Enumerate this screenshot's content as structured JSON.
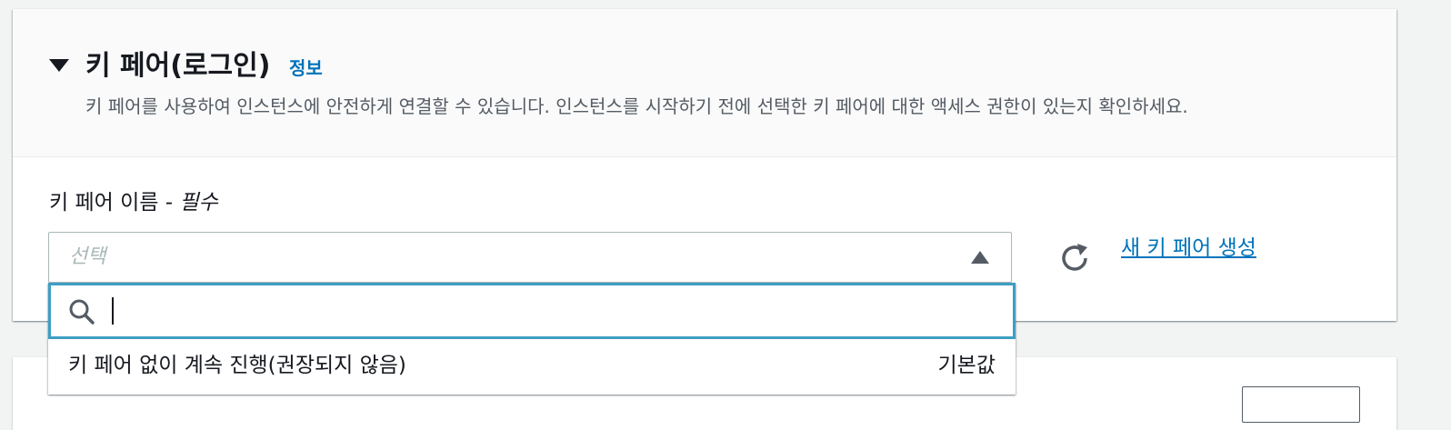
{
  "section": {
    "title": "키 페어(로그인)",
    "info_link": "정보",
    "description": "키 페어를 사용하여 인스턴스에 안전하게 연결할 수 있습니다. 인스턴스를 시작하기 전에 선택한 키 페어에 대한 액세스 권한이 있는지 확인하세요."
  },
  "key_pair_field": {
    "label": "키 페어 이름 - ",
    "required": "필수",
    "placeholder": "선택",
    "create_link": "새 키 페어 생성"
  },
  "dropdown": {
    "search_value": "",
    "options": [
      {
        "label": "키 페어 없이 계속 진행(권장되지 않음)",
        "tag": "기본값"
      }
    ]
  },
  "colors": {
    "link": "#0073bb",
    "focus_border": "#3f9ec4",
    "header_bg": "#fafafa",
    "page_bg": "#f2f3f3"
  },
  "icons": {
    "expand": "caret-down-icon",
    "select": "caret-up-icon",
    "refresh": "refresh-icon",
    "search": "search-icon"
  }
}
